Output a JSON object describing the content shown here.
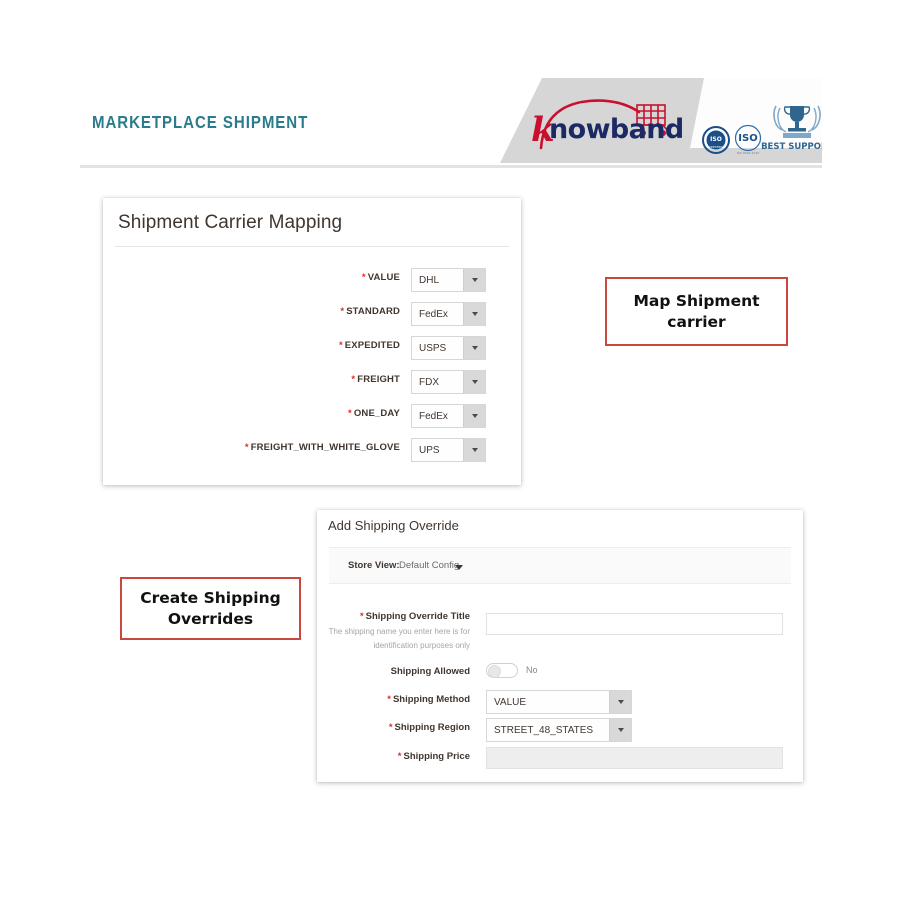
{
  "header": {
    "title": "MARKETPLACE SHIPMENT",
    "brand": {
      "name": "nowband",
      "initial": "k",
      "badges": [
        "iso-certified-badge",
        "iso-9001-badge",
        "best-support-badge"
      ],
      "best_support_label": "BEST SUPPORT",
      "iso_label": "ISO"
    }
  },
  "colors": {
    "title_teal": "#2a7b8c",
    "required_red": "#e02b27",
    "callout_red": "#c9473f",
    "brand_navy": "#1b2a63",
    "brand_red": "#c8102e",
    "banner_gray": "#d6d6d6"
  },
  "carrier_card": {
    "title": "Shipment Carrier Mapping",
    "rows": [
      {
        "label": "VALUE",
        "required": true,
        "value": "DHL"
      },
      {
        "label": "STANDARD",
        "required": true,
        "value": "FedEx"
      },
      {
        "label": "EXPEDITED",
        "required": true,
        "value": "USPS"
      },
      {
        "label": "FREIGHT",
        "required": true,
        "value": "FDX"
      },
      {
        "label": "ONE_DAY",
        "required": true,
        "value": "FedEx"
      },
      {
        "label": "FREIGHT_WITH_WHITE_GLOVE",
        "required": true,
        "value": "UPS"
      }
    ]
  },
  "override_card": {
    "title": "Add Shipping Override",
    "store_view": {
      "label": "Store View:",
      "value": "Default Config"
    },
    "fields": {
      "title": {
        "label": "Shipping Override Title",
        "note_line1": "The shipping name you enter here is for",
        "note_line2": "identification purposes only",
        "value": ""
      },
      "allowed": {
        "label": "Shipping Allowed",
        "state": "No"
      },
      "method": {
        "label": "Shipping Method",
        "value": "VALUE"
      },
      "region": {
        "label": "Shipping Region",
        "value": "STREET_48_STATES"
      },
      "price": {
        "label": "Shipping Price",
        "value": ""
      }
    }
  },
  "callouts": {
    "map_carrier": "Map Shipment carrier",
    "create_overrides": "Create Shipping Overrides"
  }
}
